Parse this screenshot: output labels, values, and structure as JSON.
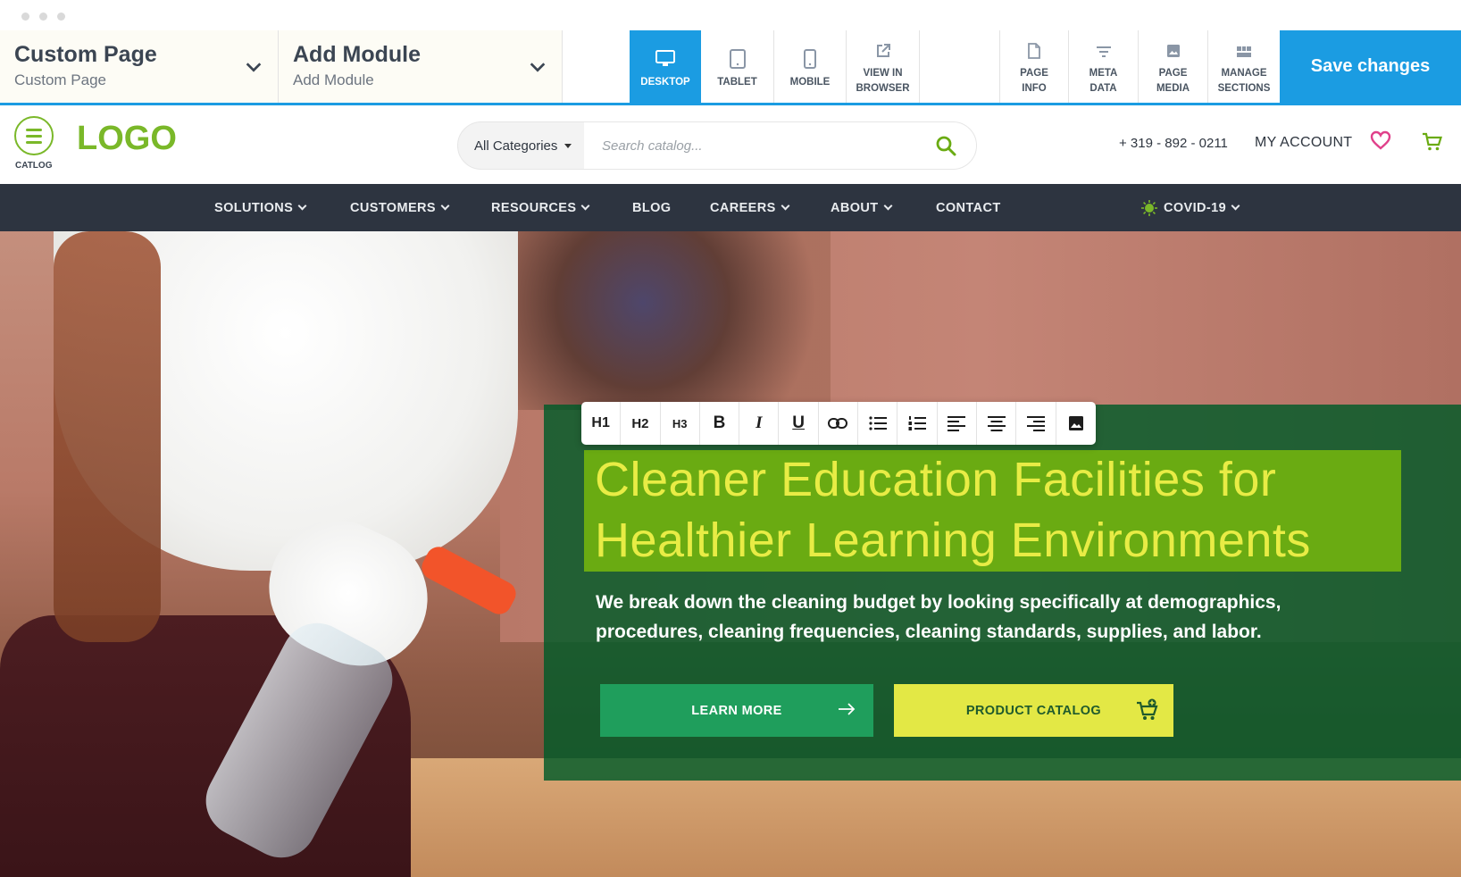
{
  "editor": {
    "page_select": {
      "title": "Custom Page",
      "subtitle": "Custom Page"
    },
    "module_select": {
      "title": "Add Module",
      "subtitle": "Add Module"
    },
    "views": [
      {
        "label": "DESKTOP",
        "icon": "desktop-icon",
        "active": true
      },
      {
        "label": "TABLET",
        "icon": "tablet-icon",
        "active": false
      },
      {
        "label": "MOBILE",
        "icon": "mobile-icon",
        "active": false
      },
      {
        "label_line1": "VIEW IN",
        "label_line2": "BROWSER",
        "icon": "external-link-icon",
        "active": false
      }
    ],
    "tools": [
      {
        "line1": "PAGE",
        "line2": "INFO",
        "icon": "page-icon"
      },
      {
        "line1": "META",
        "line2": "DATA",
        "icon": "filter-icon"
      },
      {
        "line1": "PAGE",
        "line2": "MEDIA",
        "icon": "image-icon"
      },
      {
        "line1": "MANAGE",
        "line2": "SECTIONS",
        "icon": "sections-icon"
      }
    ],
    "save_label": "Save changes",
    "accent_color": "#1b9ce2"
  },
  "header": {
    "catlog_label": "CATLOG",
    "logo": "LOGO",
    "search": {
      "category": "All Categories",
      "placeholder": "Search catalog..."
    },
    "phone": "+ 319 - 892 - 0211",
    "account": "MY ACCOUNT",
    "brand_color": "#7ab829"
  },
  "nav": {
    "items": [
      {
        "label": "SOLUTIONS",
        "dropdown": true
      },
      {
        "label": "CUSTOMERS",
        "dropdown": true
      },
      {
        "label": "RESOURCES",
        "dropdown": true
      },
      {
        "label": "BLOG",
        "dropdown": false
      },
      {
        "label": "CAREERS",
        "dropdown": true
      },
      {
        "label": "ABOUT",
        "dropdown": true
      },
      {
        "label": "CONTACT",
        "dropdown": false
      },
      {
        "label": "COVID-19",
        "dropdown": true
      }
    ]
  },
  "format_toolbar": {
    "buttons": [
      {
        "label": "H1",
        "name": "h1"
      },
      {
        "label": "H2",
        "name": "h2"
      },
      {
        "label": "H3",
        "name": "h3"
      },
      {
        "label": "B",
        "name": "bold"
      },
      {
        "label": "I",
        "name": "italic"
      },
      {
        "label": "U",
        "name": "underline"
      }
    ]
  },
  "hero": {
    "headline": "Cleaner  Education Facilities for\nHealthier Learning Environments",
    "description": "We break down the cleaning budget by looking specifically at demographics, procedures, cleaning frequencies, cleaning standards, supplies, and labor.",
    "learn_more": "LEARN MORE",
    "product_catalog": "PRODUCT CATALOG",
    "overlay_color": "#005a28",
    "headline_highlight": "#6aab12",
    "headline_color": "#e8ec45"
  }
}
